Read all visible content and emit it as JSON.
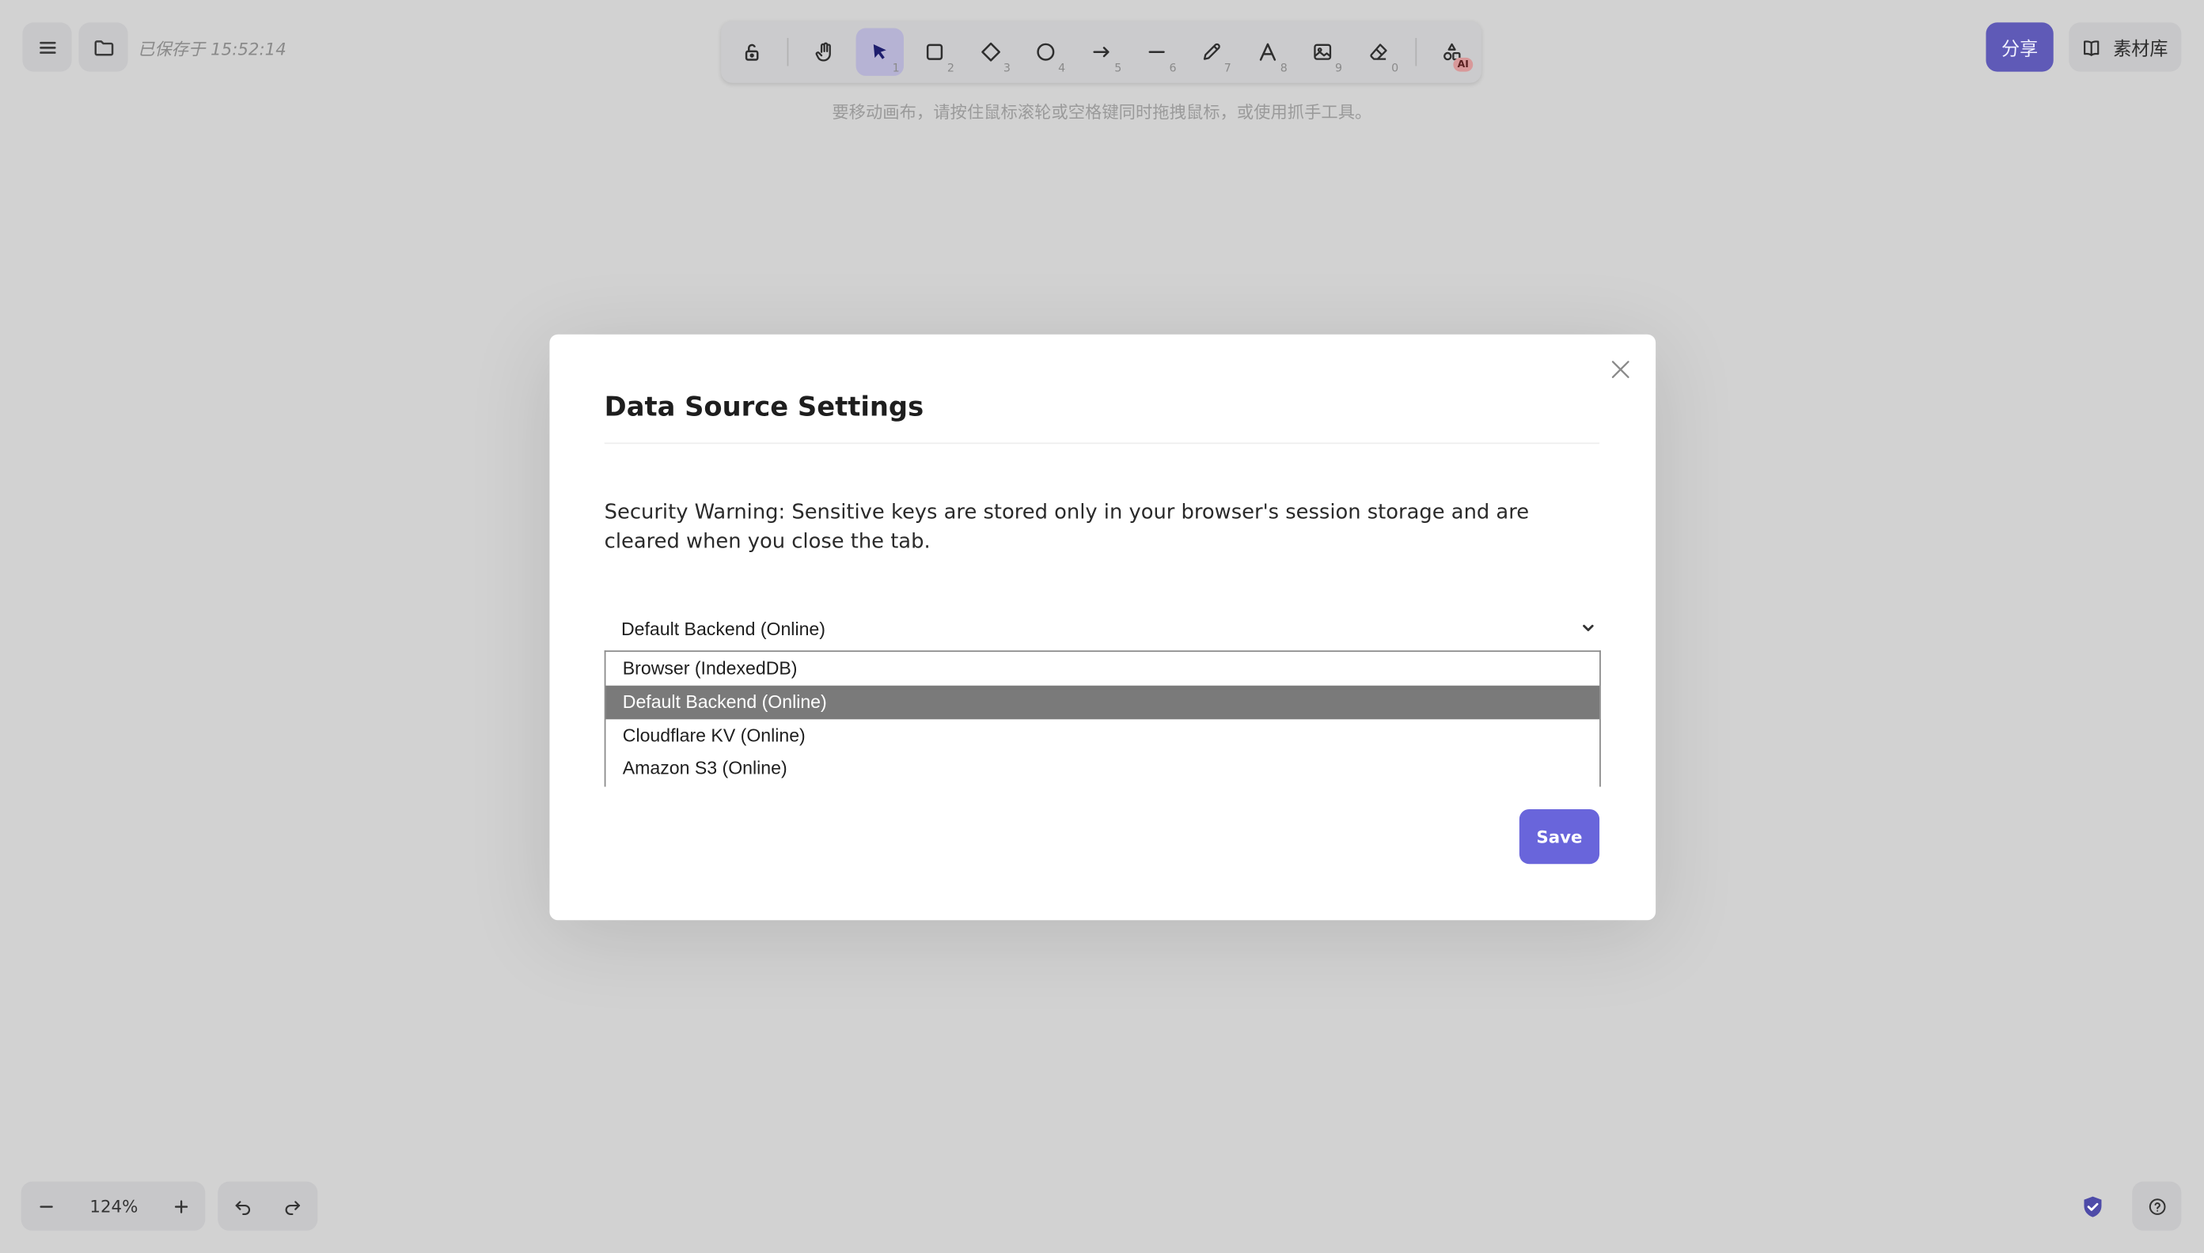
{
  "header": {
    "saved_status": "已保存于 15:52:14",
    "canvas_hint": "要移动画布，请按住鼠标滚轮或空格键同时拖拽鼠标，或使用抓手工具。",
    "share_label": "分享",
    "library_label": "素材库"
  },
  "toolbar": {
    "keys": {
      "select": "1",
      "rectangle": "2",
      "diamond": "3",
      "ellipse": "4",
      "arrow": "5",
      "line": "6",
      "pencil": "7",
      "text": "8",
      "image": "9",
      "eraser": "0"
    },
    "ai_badge": "AI",
    "active_tool": "select"
  },
  "footer": {
    "zoom_level": "124%"
  },
  "dialog": {
    "title": "Data Source Settings",
    "warning": "Security Warning: Sensitive keys are stored only in your browser's session storage and are cleared when you close the tab.",
    "select_value": "Default Backend (Online)",
    "options": [
      "Browser (IndexedDB)",
      "Default Backend (Online)",
      "Cloudflare KV (Online)",
      "Amazon S3 (Online)"
    ],
    "selected_index": 1,
    "save_label": "Save"
  },
  "colors": {
    "accent": "#6965db",
    "share_button": "#5f5ab7",
    "active_tool": "#b6b3d4",
    "overlay_bg": "#d2d2d2"
  }
}
